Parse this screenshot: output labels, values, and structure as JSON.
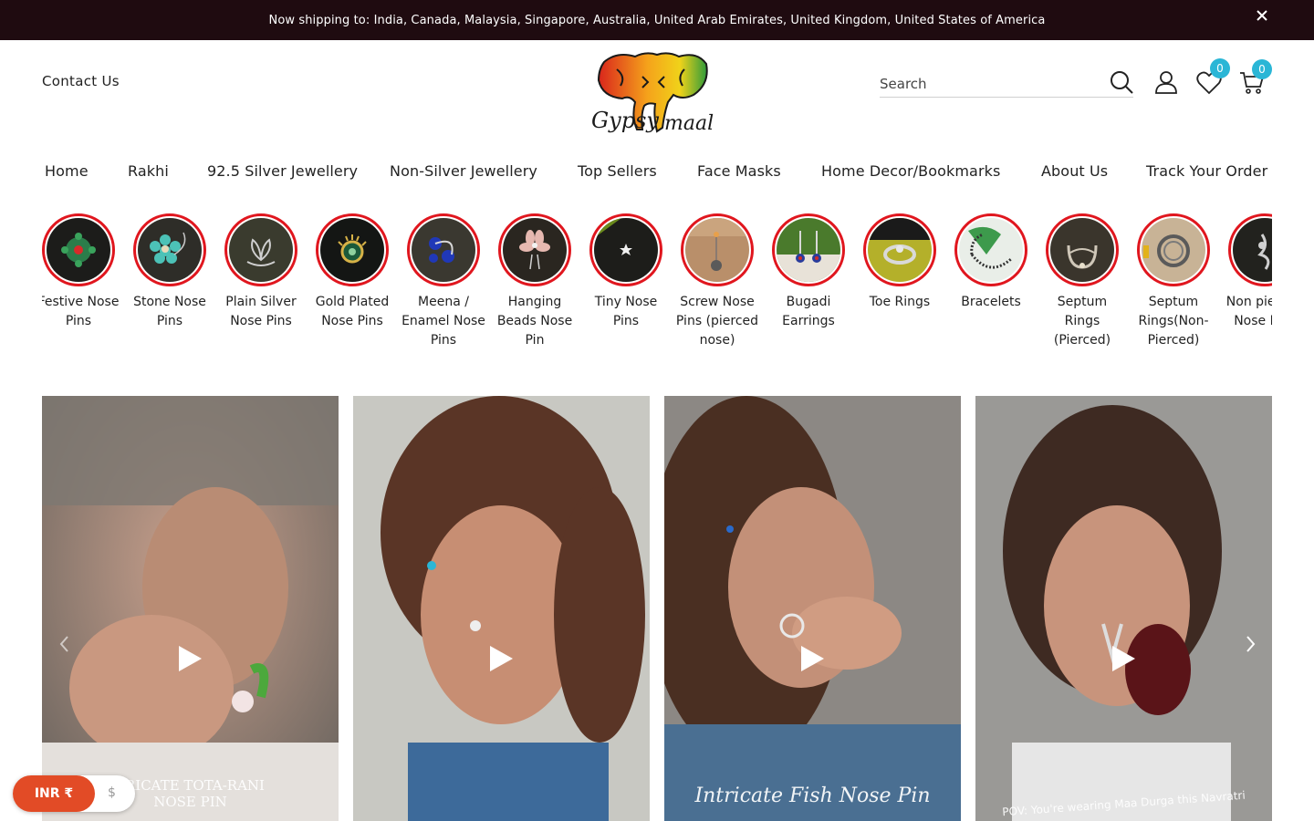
{
  "announcement": {
    "text": "Now shipping to: India, Canada, Malaysia, Singapore, Australia, United Arab Emirates, United Kingdom, United States of America",
    "close_icon": "close-icon"
  },
  "header": {
    "contact_label": "Contact Us",
    "logo_text": "Gypsy maal",
    "search_placeholder": "Search",
    "wishlist_count": "0",
    "cart_count": "0"
  },
  "nav": {
    "items": [
      "Home",
      "Rakhi",
      "92.5 Silver Jewellery",
      "Non-Silver Jewellery",
      "Top Sellers",
      "Face Masks",
      "Home Decor/Bookmarks",
      "About Us",
      "Track Your Order"
    ]
  },
  "categories": [
    "Festive Nose Pins",
    "Stone Nose Pins",
    "Plain Silver Nose Pins",
    "Gold Plated Nose Pins",
    "Meena / Enamel Nose Pins",
    "Hanging Beads Nose Pin",
    "Tiny Nose Pins",
    "Screw Nose Pins (pierced nose)",
    "Bugadi Earrings",
    "Toe Rings",
    "Bracelets",
    "Septum Rings (Pierced)",
    "Septum Rings(Non-Pierced)",
    "Non pierced Nose Pins"
  ],
  "videos": {
    "captions": [
      "TRICATE TOTA-RANI NOSE PIN",
      "",
      "Intricate Fish Nose Pin",
      "POV: You're wearing Maa Durga this Navratri"
    ]
  },
  "currency": {
    "active": "INR ₹",
    "other": "$"
  },
  "colors": {
    "announcement_bg": "#1f0b10",
    "ring": "#e0161e",
    "badge": "#2ab6d6",
    "currency_active": "#e24b26"
  }
}
